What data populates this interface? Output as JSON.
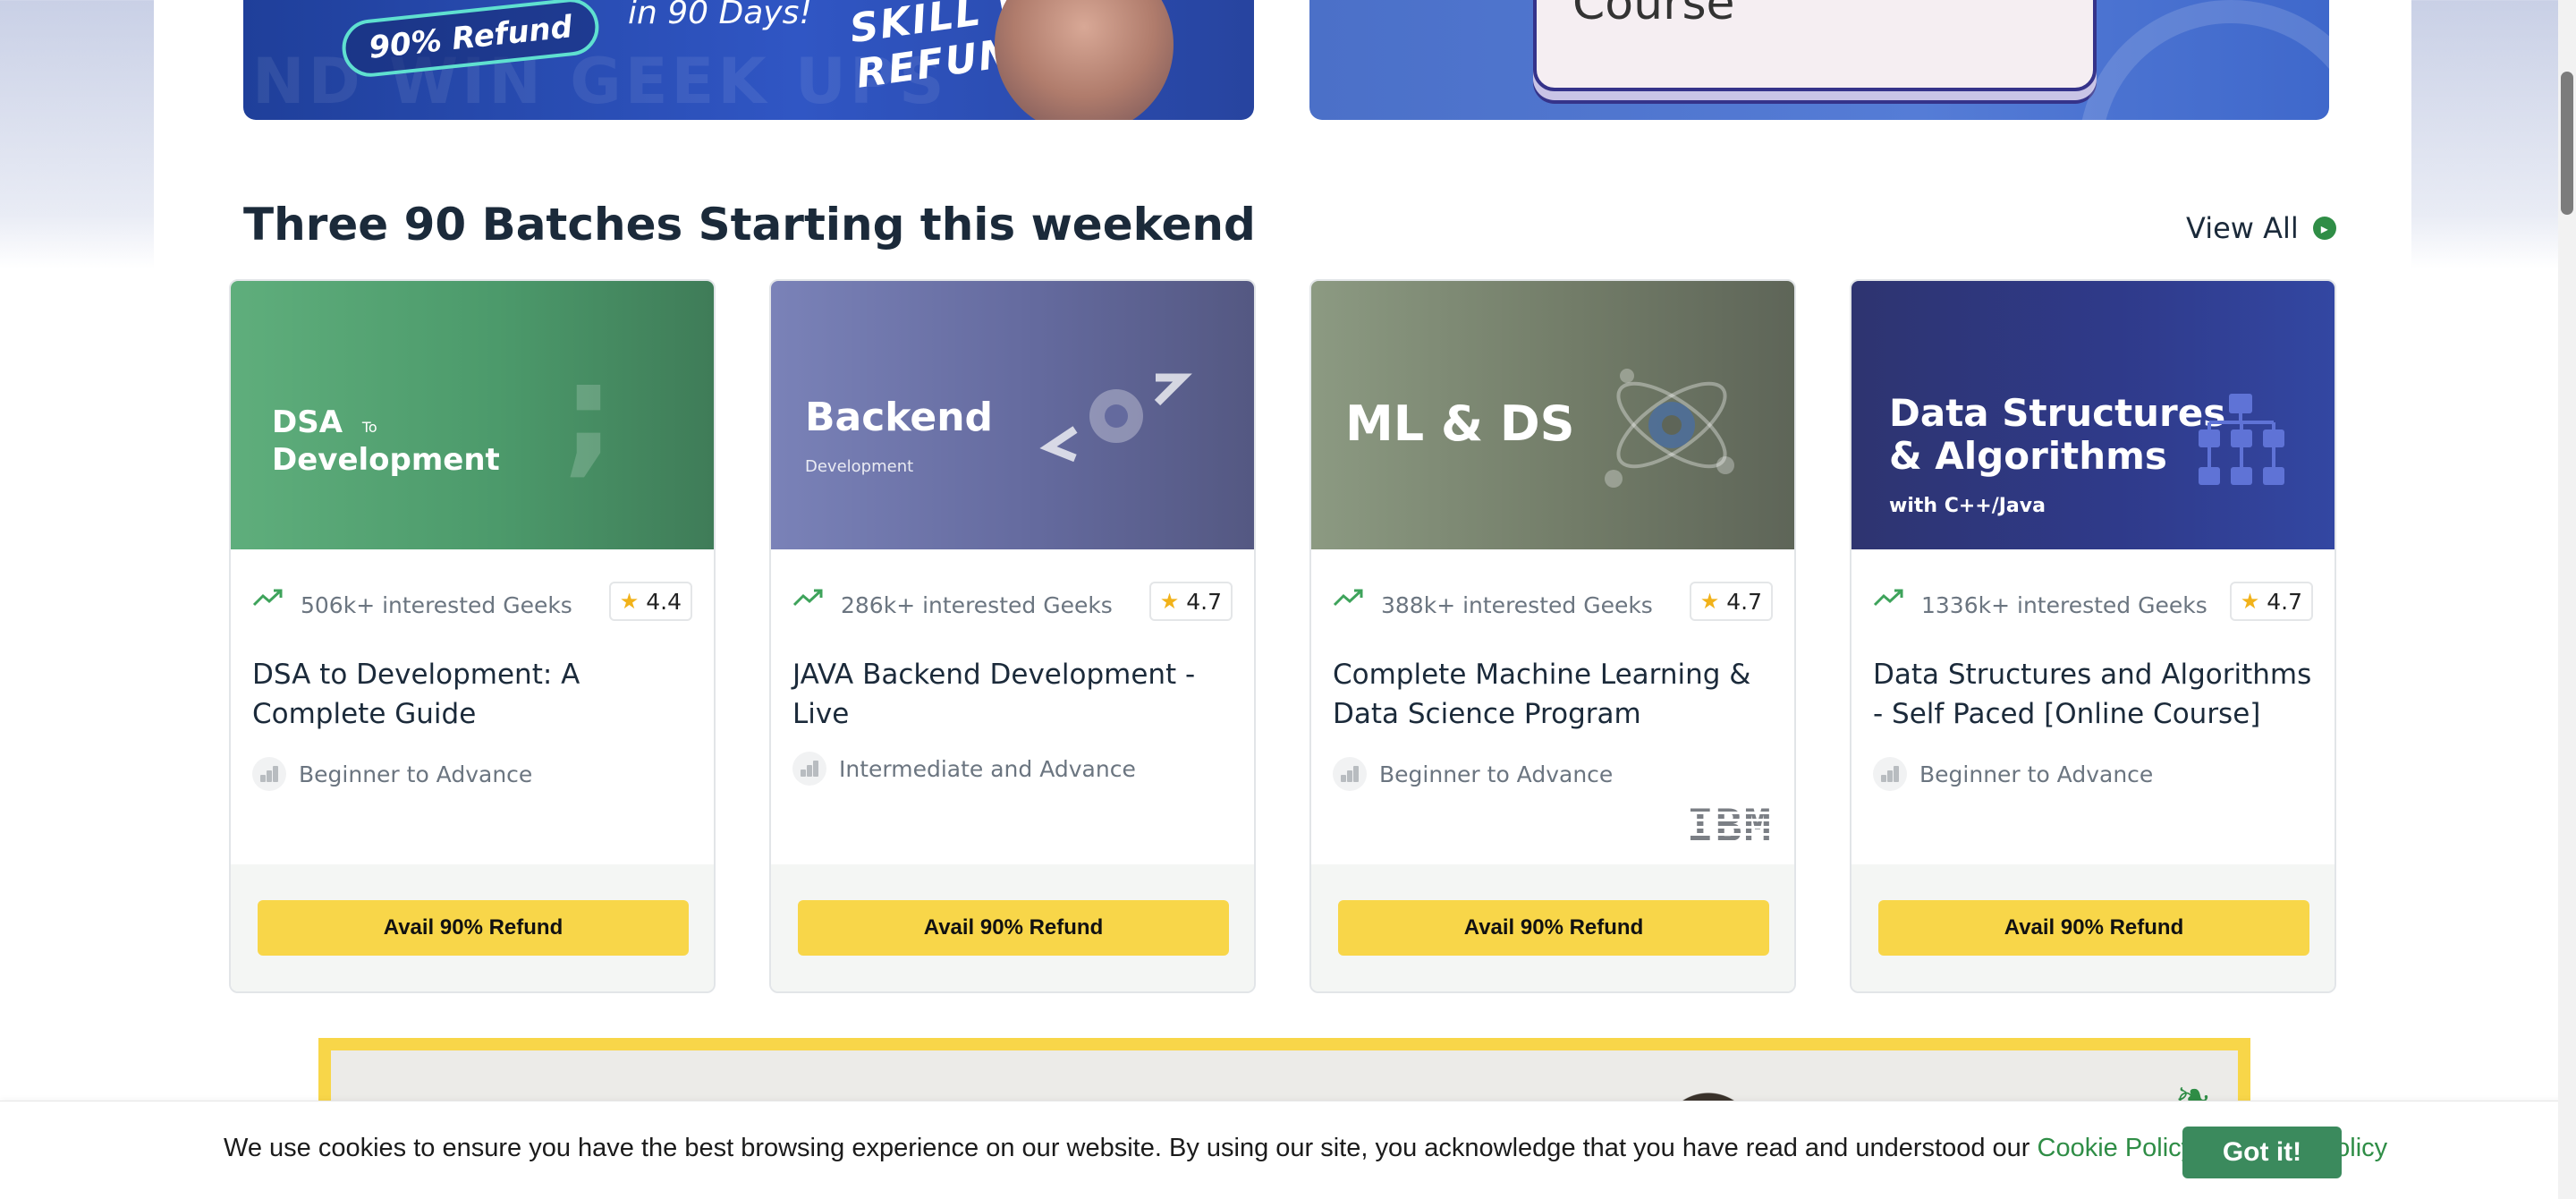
{
  "banners": {
    "left": {
      "refund_text": "90% Refund",
      "days_text": "in 90 Days!",
      "slogan_text": "SKILL WIN REFUND UPS",
      "ghost_text": "ND WIN GEEK UPS"
    },
    "right": {
      "card_text": "Course"
    }
  },
  "section": {
    "title": "Three 90 Batches Starting this weekend",
    "view_all_label": "View All",
    "view_all_icon": "chevron-right-icon"
  },
  "cards": [
    {
      "hero_title_line1": "DSA",
      "hero_title_small": "To",
      "hero_title_line2": "Development",
      "hero_icon": "semicolon-icon",
      "interested": "506k+ interested Geeks",
      "rating": "4.4",
      "title": "DSA to Development: A Complete Guide",
      "level": "Beginner to Advance",
      "button": "Avail 90% Refund"
    },
    {
      "hero_title_line1": "Backend",
      "hero_subtitle": "Development",
      "hero_icon": "code-gear-icon",
      "interested": "286k+ interested Geeks",
      "rating": "4.7",
      "title": "JAVA Backend Development - Live",
      "level": "Intermediate and Advance",
      "button": "Avail 90% Refund"
    },
    {
      "hero_title_line1": "ML & DS",
      "hero_icon": "atom-gear-icon",
      "interested": "388k+ interested Geeks",
      "rating": "4.7",
      "title": "Complete Machine Learning & Data Science Program",
      "level": "Beginner to Advance",
      "partner_logo": "IBM",
      "button": "Avail 90% Refund"
    },
    {
      "hero_title_line1": "Data Structures",
      "hero_title_line2": "& Algorithms",
      "hero_subtitle": "with C++/Java",
      "hero_icon": "hierarchy-icon",
      "interested": "1336k+ interested Geeks",
      "rating": "4.7",
      "title": "Data Structures and Algorithms - Self Paced [Online Course]",
      "level": "Beginner to Advance",
      "button": "Avail 90% Refund"
    }
  ],
  "cookie": {
    "text": "We use cookies to ensure you have the best browsing experience on our website. By using our site, you acknowledge that you have read and understood our",
    "cookie_policy": "Cookie Policy",
    "amp": "&",
    "privacy_policy": "Privacy Policy",
    "button": "Got it!"
  },
  "colors": {
    "brand_green": "#2f8d46",
    "button_yellow": "#f8d649",
    "cookie_button": "#3b8a5d"
  }
}
